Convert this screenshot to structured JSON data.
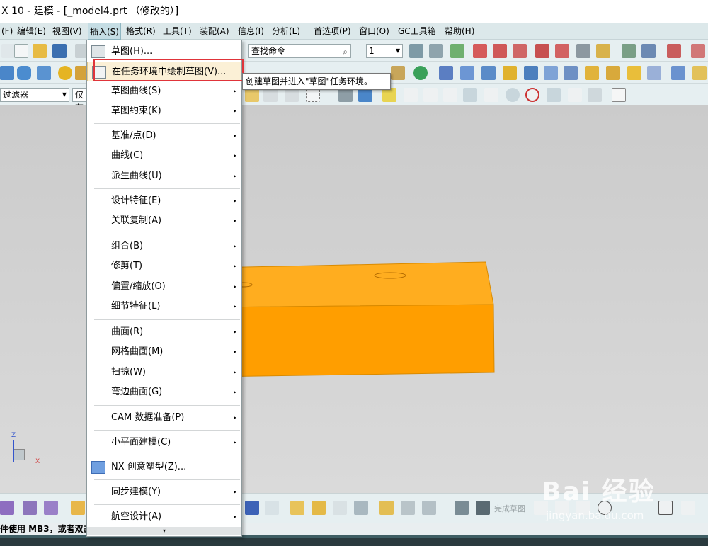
{
  "window": {
    "title": "X 10 - 建模 - [_model4.prt （修改的）]"
  },
  "menubar": {
    "items": [
      {
        "label": "(F)",
        "name": "menu-file"
      },
      {
        "label": "编辑(E)",
        "name": "menu-edit"
      },
      {
        "label": "视图(V)",
        "name": "menu-view"
      },
      {
        "label": "插入(S)",
        "name": "menu-insert"
      },
      {
        "label": "格式(R)",
        "name": "menu-format"
      },
      {
        "label": "工具(T)",
        "name": "menu-tools"
      },
      {
        "label": "装配(A)",
        "name": "menu-assembly"
      },
      {
        "label": "信息(I)",
        "name": "menu-info"
      },
      {
        "label": "分析(L)",
        "name": "menu-analysis"
      },
      {
        "label": "首选项(P)",
        "name": "menu-preferences"
      },
      {
        "label": "窗口(O)",
        "name": "menu-window"
      },
      {
        "label": "GC工具箱",
        "name": "menu-gc-toolbox"
      },
      {
        "label": "帮助(H)",
        "name": "menu-help"
      }
    ]
  },
  "toolbar": {
    "search_placeholder": "查找命令",
    "number_combo": "1",
    "filter_combo": "过滤器",
    "scope_combo": "仅在"
  },
  "insert_menu": {
    "items": [
      {
        "label": "草图(H)...",
        "submenu": false
      },
      {
        "label": "在任务环境中绘制草图(V)...",
        "submenu": false
      },
      {
        "label": "草图曲线(S)",
        "submenu": true
      },
      {
        "label": "草图约束(K)",
        "submenu": true
      },
      {
        "label": "基准/点(D)",
        "submenu": true
      },
      {
        "label": "曲线(C)",
        "submenu": true
      },
      {
        "label": "派生曲线(U)",
        "submenu": true
      },
      {
        "label": "设计特征(E)",
        "submenu": true
      },
      {
        "label": "关联复制(A)",
        "submenu": true
      },
      {
        "label": "组合(B)",
        "submenu": true
      },
      {
        "label": "修剪(T)",
        "submenu": true
      },
      {
        "label": "偏置/缩放(O)",
        "submenu": true
      },
      {
        "label": "细节特征(L)",
        "submenu": true
      },
      {
        "label": "曲面(R)",
        "submenu": true
      },
      {
        "label": "网格曲面(M)",
        "submenu": true
      },
      {
        "label": "扫掠(W)",
        "submenu": true
      },
      {
        "label": "弯边曲面(G)",
        "submenu": true
      },
      {
        "label": "CAM 数据准备(P)",
        "submenu": true
      },
      {
        "label": "小平面建模(C)",
        "submenu": true
      },
      {
        "label": "NX 创意塑型(Z)...",
        "submenu": false
      },
      {
        "label": "同步建模(Y)",
        "submenu": true
      },
      {
        "label": "航空设计(A)",
        "submenu": true
      }
    ],
    "arrow_glyph": "▸",
    "more_glyph": "▾"
  },
  "tooltip": {
    "text": "创建草图并进入\"草图\"任务环境。"
  },
  "bottom_toolbar": {
    "finish_sketch": "完成草图"
  },
  "status": {
    "text": "件使用 MB3，或者双击"
  },
  "triad": {
    "x_label": "X",
    "z_label": "Z"
  },
  "watermark": {
    "main": "Bai 经验",
    "sub": "jingyan.baidu.com"
  },
  "colors": {
    "part_top": "#ffad1f",
    "part_front": "#ff9e00",
    "highlight_border": "#e0343a",
    "menu_highlight": "#fbf0d6"
  }
}
